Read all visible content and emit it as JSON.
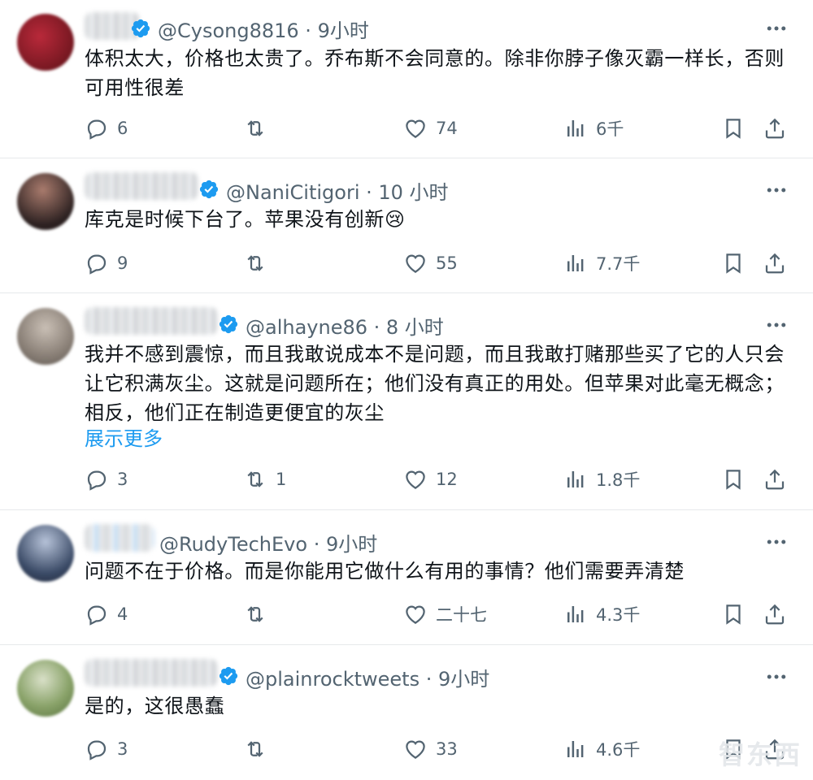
{
  "tweets": [
    {
      "handle": "@Cysong8816",
      "time": "9小时",
      "text": "体积太大，价格也太贵了。乔布斯不会同意的。除非你脖子像灭霸一样长，否则可用性很差",
      "show_more": "",
      "replies": "6",
      "retweets": "",
      "likes": "74",
      "views": "6千",
      "avatar_colors": [
        "#7a1a22",
        "#b9293a"
      ]
    },
    {
      "handle": "@NaniCitigori",
      "time": "10 小时",
      "text": "库克是时候下台了。苹果没有创新😢",
      "show_more": "",
      "replies": "9",
      "retweets": "",
      "likes": "55",
      "views": "7.7千",
      "avatar_colors": [
        "#2b2020",
        "#a97b6d"
      ]
    },
    {
      "handle": "@alhayne86",
      "time": "8 小时",
      "text": "我并不感到震惊，而且我敢说成本不是问题，而且我敢打赌那些买了它的人只会让它积满灰尘。这就是问题所在；他们没有真正的用处。但苹果对此毫无概念；相反，他们正在制造更便宜的灰尘",
      "show_more": "展示更多",
      "replies": "3",
      "retweets": "1",
      "likes": "12",
      "views": "1.8千",
      "avatar_colors": [
        "#8a8077",
        "#c9bfb5"
      ]
    },
    {
      "handle": "@RudyTechEvo",
      "time": "9小时",
      "text": "问题不在于价格。而是你能用它做什么有用的事情？他们需要弄清楚",
      "show_more": "",
      "replies": "4",
      "retweets": "",
      "likes": "二十七",
      "views": "4.3千",
      "avatar_colors": [
        "#3a4a66",
        "#b6c2d8"
      ]
    },
    {
      "handle": "@plainrocktweets",
      "time": "9小时",
      "text": "是的，这很愚蠢",
      "show_more": "",
      "replies": "3",
      "retweets": "",
      "likes": "33",
      "views": "4.6千",
      "avatar_colors": [
        "#8aa36a",
        "#d9e0c8"
      ]
    }
  ],
  "watermark": "智东西",
  "colors": {
    "text": "#0f1419",
    "muted": "#536471",
    "link": "#1d9bf0",
    "verified": "#1d9bf0",
    "divider": "#e6e9eb"
  },
  "icons": {
    "reply": "reply-icon",
    "retweet": "retweet-icon",
    "like": "heart-icon",
    "views": "views-chart-icon",
    "bookmark": "bookmark-icon",
    "share": "share-icon",
    "more": "more-dots-icon",
    "verified": "verified-badge-icon"
  }
}
